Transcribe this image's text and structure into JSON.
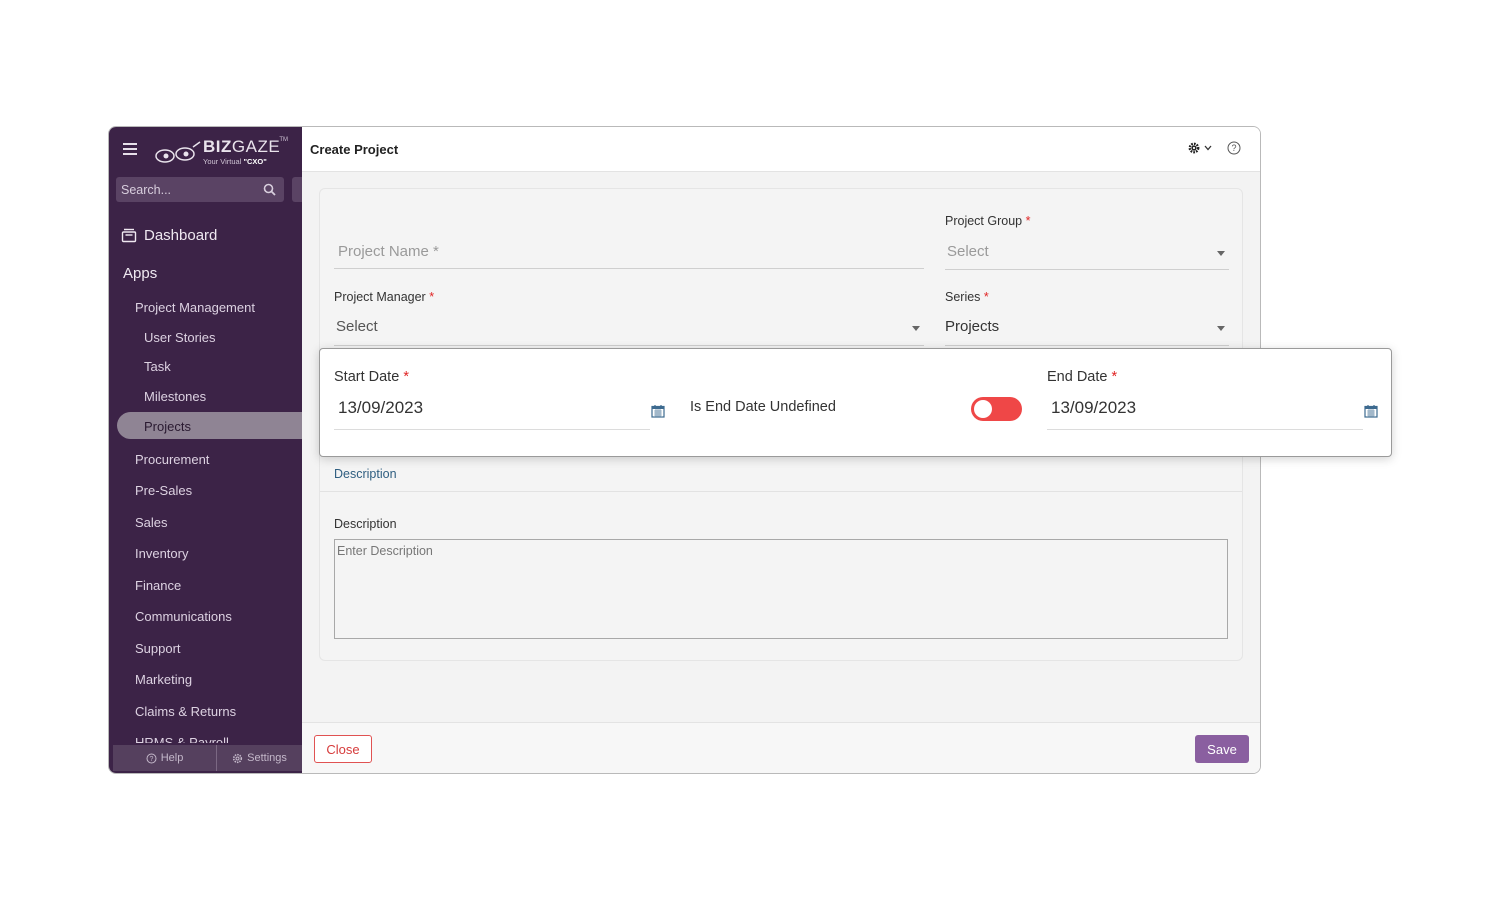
{
  "brand": {
    "name_bold": "BIZ",
    "name_light": "GAZE",
    "tagline_prefix": "Your Virtual ",
    "tagline_bold": "\"CXO\"",
    "tm": "TM"
  },
  "sidebar": {
    "search_placeholder": "Search...",
    "dashboard": "Dashboard",
    "apps": "Apps",
    "items": [
      {
        "label": "Project Management"
      },
      {
        "label": "User Stories"
      },
      {
        "label": "Task"
      },
      {
        "label": "Milestones"
      },
      {
        "label": "Projects"
      },
      {
        "label": "Procurement"
      },
      {
        "label": "Pre-Sales"
      },
      {
        "label": "Sales"
      },
      {
        "label": "Inventory"
      },
      {
        "label": "Finance"
      },
      {
        "label": "Communications"
      },
      {
        "label": "Support"
      },
      {
        "label": "Marketing"
      },
      {
        "label": "Claims & Returns"
      },
      {
        "label": "HRMS & Payroll"
      }
    ],
    "active_item": "Projects",
    "footer": {
      "help": "Help",
      "settings": "Settings"
    }
  },
  "header": {
    "title": "Create Project"
  },
  "form": {
    "project_name_placeholder": "Project Name *",
    "project_group": {
      "label": "Project Group",
      "value": "Select"
    },
    "project_manager": {
      "label": "Project Manager",
      "value": "Select"
    },
    "series": {
      "label": "Series",
      "value": "Projects"
    },
    "required_mark": "*",
    "description_section": "Description",
    "description_label": "Description",
    "description_placeholder": "Enter Description"
  },
  "dates": {
    "start_label": "Start Date",
    "start_value": "13/09/2023",
    "undefined_label": "Is End Date Undefined",
    "end_date_undefined": true,
    "end_label": "End Date",
    "end_value": "13/09/2023"
  },
  "footer": {
    "close": "Close",
    "save": "Save"
  },
  "colors": {
    "sidebar": "#3c2347",
    "accent": "#8a5fa0",
    "toggle": "#ef4747",
    "close": "#d63b3b"
  }
}
